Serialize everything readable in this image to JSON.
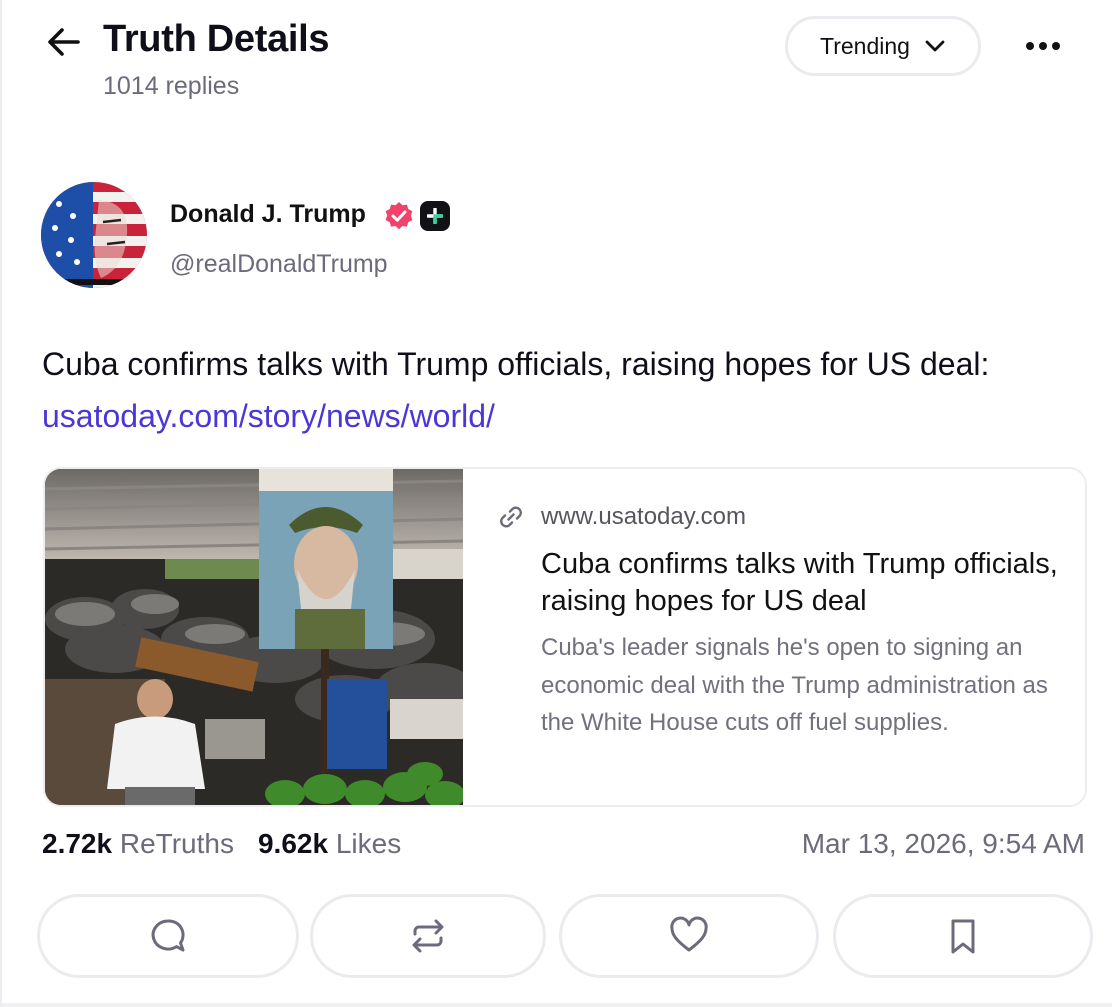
{
  "header": {
    "title": "Truth Details",
    "subtitle": "1014 replies",
    "sort_label": "Trending",
    "back_icon": "arrow-left-icon",
    "more_icon": "ellipsis-icon"
  },
  "author": {
    "name": "Donald J. Trump",
    "handle": "@realDonaldTrump",
    "verified_badge_color": "#f0426b"
  },
  "post": {
    "text": "Cuba confirms talks with Trump officials, raising hopes for US deal: ",
    "link_text": "usatoday.com/story/news/world/",
    "link_color": "#4a37d8"
  },
  "link_card": {
    "domain": "www.usatoday.com",
    "title": "Cuba confirms talks with Trump officials, raising hopes for US deal",
    "description": "Cuba's leader signals he's open to signing an economic deal with the Trump administration as the White House cuts off fuel supplies."
  },
  "stats": {
    "retruths_count": "2.72k",
    "retruths_label": "ReTruths",
    "likes_count": "9.62k",
    "likes_label": "Likes",
    "timestamp": "Mar 13, 2026, 9:54 AM"
  },
  "actions": [
    {
      "icon": "reply-icon"
    },
    {
      "icon": "retruth-icon"
    },
    {
      "icon": "heart-icon"
    },
    {
      "icon": "bookmark-icon"
    }
  ]
}
